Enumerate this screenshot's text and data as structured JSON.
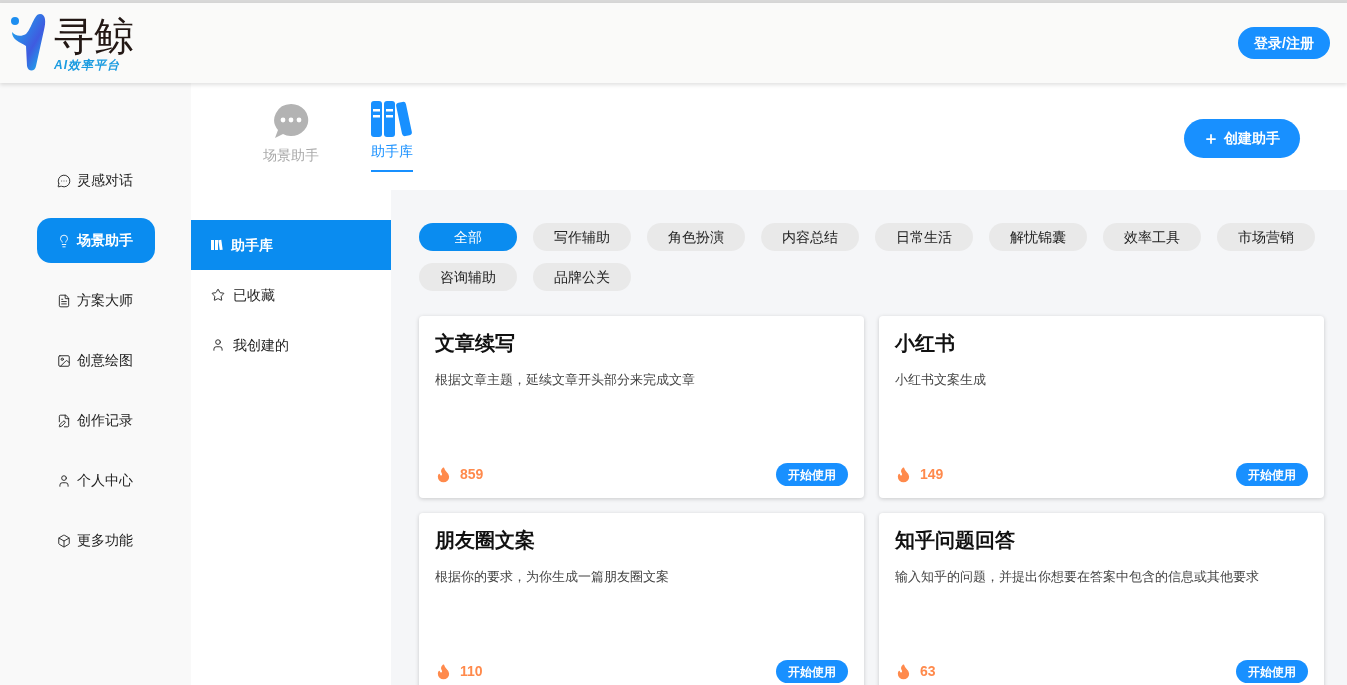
{
  "header": {
    "logo_title": "寻鲸",
    "logo_subtitle": "AI效率平台",
    "login_button": "登录/注册"
  },
  "sidebar": {
    "items": [
      {
        "label": "灵感对话",
        "kind": "chat",
        "selected": false
      },
      {
        "label": "场景助手",
        "kind": "bulb",
        "selected": true
      },
      {
        "label": "方案大师",
        "kind": "doc",
        "selected": false
      },
      {
        "label": "创意绘图",
        "kind": "image",
        "selected": false
      },
      {
        "label": "创作记录",
        "kind": "edit",
        "selected": false
      },
      {
        "label": "个人中心",
        "kind": "user",
        "selected": false
      },
      {
        "label": "更多功能",
        "kind": "box",
        "selected": false
      }
    ]
  },
  "top_tabs": [
    {
      "label": "场景助手",
      "kind": "bubble",
      "selected": false
    },
    {
      "label": "助手库",
      "kind": "books",
      "selected": true
    }
  ],
  "create_button": "创建助手",
  "subnav": [
    {
      "label": "助手库",
      "kind": "library",
      "selected": true
    },
    {
      "label": "已收藏",
      "kind": "star",
      "selected": false
    },
    {
      "label": "我创建的",
      "kind": "user",
      "selected": false
    }
  ],
  "categories": [
    {
      "label": "全部",
      "selected": true
    },
    {
      "label": "写作辅助",
      "selected": false
    },
    {
      "label": "角色扮演",
      "selected": false
    },
    {
      "label": "内容总结",
      "selected": false
    },
    {
      "label": "日常生活",
      "selected": false
    },
    {
      "label": "解忧锦囊",
      "selected": false
    },
    {
      "label": "效率工具",
      "selected": false
    },
    {
      "label": "市场营销",
      "selected": false
    },
    {
      "label": "咨询辅助",
      "selected": false
    },
    {
      "label": "品牌公关",
      "selected": false
    }
  ],
  "cards": [
    {
      "title": "文章续写",
      "description": "根据文章主题，延续文章开头部分来完成文章",
      "count": "859",
      "button": "开始使用"
    },
    {
      "title": "小红书",
      "description": "小红书文案生成",
      "count": "149",
      "button": "开始使用"
    },
    {
      "title": "朋友圈文案",
      "description": "根据你的要求，为你生成一篇朋友圈文案",
      "count": "110",
      "button": "开始使用"
    },
    {
      "title": "知乎问题回答",
      "description": "输入知乎的问题，并提出你想要在答案中包含的信息或其他要求",
      "count": "63",
      "button": "开始使用"
    }
  ]
}
